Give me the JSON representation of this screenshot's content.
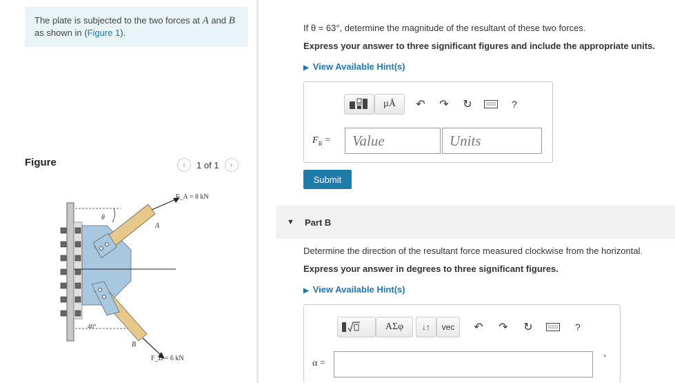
{
  "intro": {
    "text_before": "The plate is subjected to the two forces at ",
    "point_a": "A",
    "and": " and ",
    "point_b": "B",
    "text_after": " as shown in (",
    "figure_link": "Figure 1",
    "close": ")."
  },
  "figure_panel": {
    "title": "Figure",
    "pager": "1 of 1",
    "prev_icon": "chevron-left-icon",
    "next_icon": "chevron-right-icon",
    "labels": {
      "fa": "F_A = 8 kN",
      "fb": "F_B = 6 kN",
      "theta": "θ",
      "a": "A",
      "b": "B",
      "angle": "40°"
    }
  },
  "part_a": {
    "question": "If θ = 63°, determine the magnitude of the resultant of these two forces.",
    "instruction": "Express your answer to three significant figures and include the appropriate units.",
    "hint": "View Available Hint(s)",
    "toolbar": [
      "templates-icon",
      "µÅ",
      "undo-icon",
      "redo-icon",
      "reset-icon",
      "keyboard-icon",
      "?"
    ],
    "label": "F",
    "label_sub": "R",
    "equals": "=",
    "value_placeholder": "Value",
    "units_placeholder": "Units",
    "submit": "Submit"
  },
  "part_b": {
    "title": "Part B",
    "question": "Determine the direction of the resultant force measured clockwise from the horizontal.",
    "instruction": "Express your answer in degrees to three significant figures.",
    "hint": "View Available Hint(s)",
    "toolbar": [
      "sqrt-template-icon",
      "ΑΣφ",
      "↓↑",
      "vec",
      "undo-icon",
      "redo-icon",
      "reset-icon",
      "keyboard-icon",
      "?"
    ],
    "label": "α =",
    "unit": "°",
    "value": ""
  },
  "colors": {
    "accent": "#1a78b8",
    "submit": "#1f7ca8",
    "intro_bg": "#e8f4f8"
  }
}
